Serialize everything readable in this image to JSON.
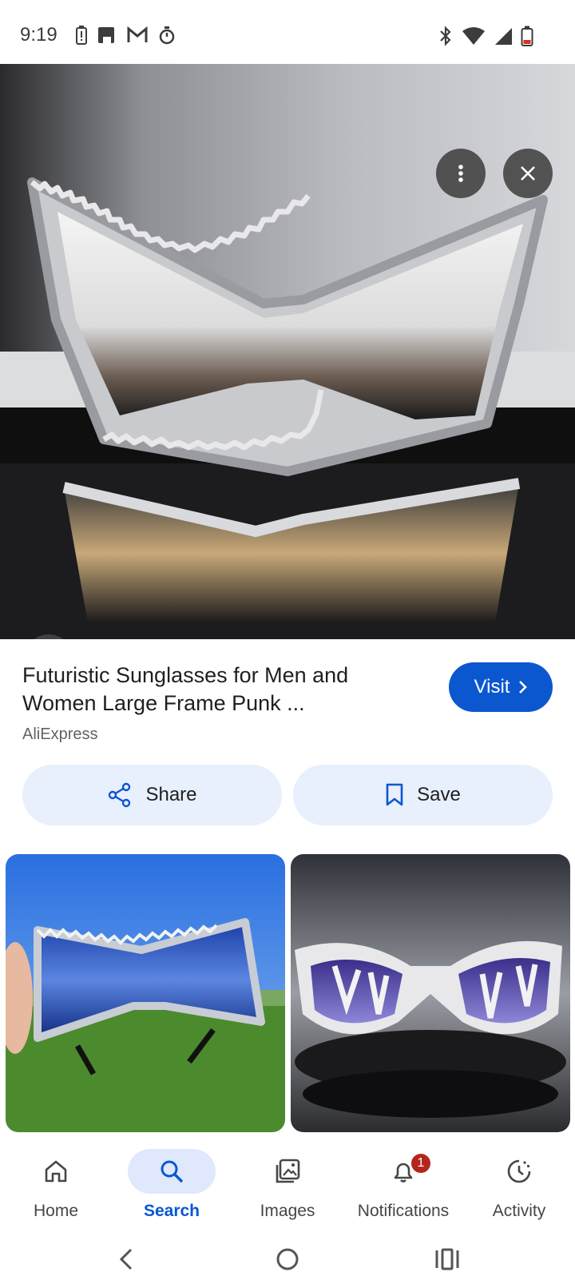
{
  "status_bar": {
    "time": "9:19",
    "left_icons": [
      "battery-alert-icon",
      "clipboard-icon",
      "gmail-icon",
      "timer-icon"
    ],
    "right_icons": [
      "bluetooth-icon",
      "wifi-icon",
      "signal-icon",
      "battery-low-icon"
    ]
  },
  "result": {
    "title": "Futuristic Sunglasses for Men and Women Large Frame Punk ...",
    "source": "AliExpress",
    "visit_label": "Visit",
    "share_label": "Share",
    "save_label": "Save"
  },
  "bottom_nav": {
    "items": [
      {
        "label": "Home",
        "icon": "home-icon"
      },
      {
        "label": "Search",
        "icon": "search-icon"
      },
      {
        "label": "Images",
        "icon": "images-icon"
      },
      {
        "label": "Notifications",
        "icon": "bell-icon",
        "badge": "1"
      },
      {
        "label": "Activity",
        "icon": "activity-icon"
      }
    ],
    "active": "Search"
  },
  "colors": {
    "accent": "#0b57d0",
    "pill_bg": "#e8effd",
    "badge": "#b3261e"
  }
}
